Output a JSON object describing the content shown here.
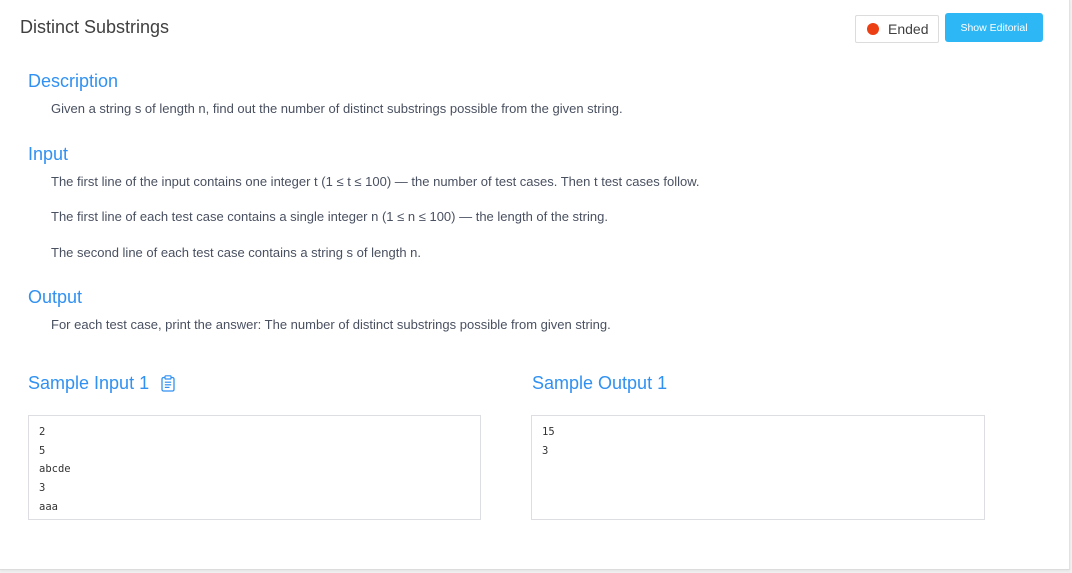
{
  "problem": {
    "title": "Distinct Substrings",
    "status": "Ended",
    "show_editorial_label": "Show Editorial"
  },
  "colors": {
    "accent": "#3091f2",
    "button": "#2db7f5",
    "status_dot": "#ed3f14"
  },
  "description": {
    "heading": "Description",
    "text": "Given a string s of length n, find out the number of distinct substrings possible from the given string."
  },
  "input": {
    "heading": "Input",
    "lines": [
      "The first line of the input contains one integer t (1 ≤ t ≤ 100) — the number of test cases. Then t test cases follow.",
      "The first line of each test case contains a single integer n (1 ≤ n ≤ 100) — the length of the string.",
      "The second line of each test case contains a string s of length n."
    ]
  },
  "output": {
    "heading": "Output",
    "text": "For each test case, print the answer: The number of distinct substrings possible from given string."
  },
  "samples": {
    "input_heading": "Sample Input 1",
    "input_icon": "clipboard-icon",
    "output_heading": "Sample Output 1",
    "input_lines": [
      "2",
      "5",
      "abcde",
      "3",
      "aaa"
    ],
    "output_lines": [
      "15",
      "3"
    ]
  }
}
